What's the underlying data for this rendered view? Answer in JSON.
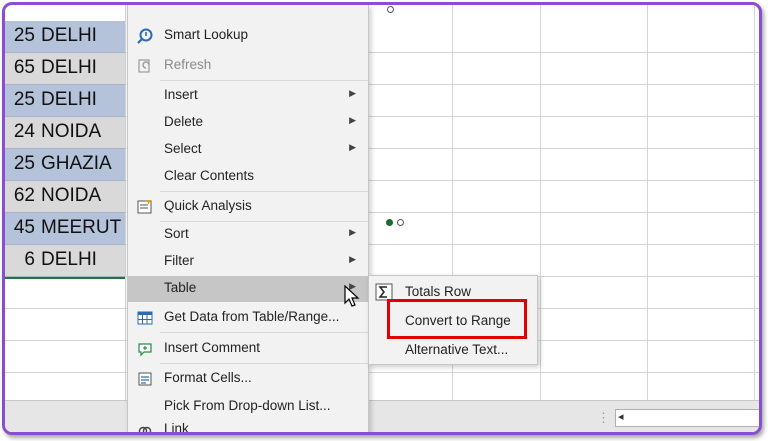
{
  "table_rows": [
    {
      "num": "25",
      "city": "DELHI"
    },
    {
      "num": "65",
      "city": "DELHI"
    },
    {
      "num": "25",
      "city": "DELHI"
    },
    {
      "num": "24",
      "city": "NOIDA"
    },
    {
      "num": "25",
      "city": "GHAZIA"
    },
    {
      "num": "62",
      "city": "NOIDA"
    },
    {
      "num": "45",
      "city": "MEERUT"
    },
    {
      "num": "6",
      "city": "DELHI"
    }
  ],
  "context_menu": {
    "items": [
      {
        "label": "Smart Lookup",
        "icon": "smart-lookup-icon"
      },
      {
        "label": "Refresh",
        "icon": "refresh-icon",
        "disabled": true
      },
      {
        "label": "Insert",
        "submenu": true
      },
      {
        "label": "Delete",
        "submenu": true
      },
      {
        "label": "Select",
        "submenu": true
      },
      {
        "label": "Clear Contents"
      },
      {
        "label": "Quick Analysis",
        "icon": "quick-analysis-icon"
      },
      {
        "label": "Sort",
        "submenu": true
      },
      {
        "label": "Filter",
        "submenu": true
      },
      {
        "label": "Table",
        "submenu": true,
        "highlighted": true
      },
      {
        "label": "Get Data from Table/Range...",
        "icon": "table-data-icon"
      },
      {
        "label": "Insert Comment",
        "icon": "comment-icon"
      },
      {
        "label": "Format Cells...",
        "icon": "format-cells-icon"
      },
      {
        "label": "Pick From Drop-down List..."
      },
      {
        "label": "Link",
        "icon": "link-icon"
      }
    ]
  },
  "table_submenu": {
    "items": [
      {
        "label": "Totals Row",
        "icon": "sigma-icon"
      },
      {
        "label": "Convert to Range",
        "highlighted_by_annotation": true
      },
      {
        "label": "Alternative Text..."
      }
    ]
  },
  "colors": {
    "frame_border": "#8a4fd0",
    "row_band_dark": "#b4c3d9",
    "row_band_light": "#d9d9d9",
    "annotation_red": "#e00000",
    "menu_bg": "#f2f2f2",
    "menu_hover": "#c6c6c6"
  }
}
